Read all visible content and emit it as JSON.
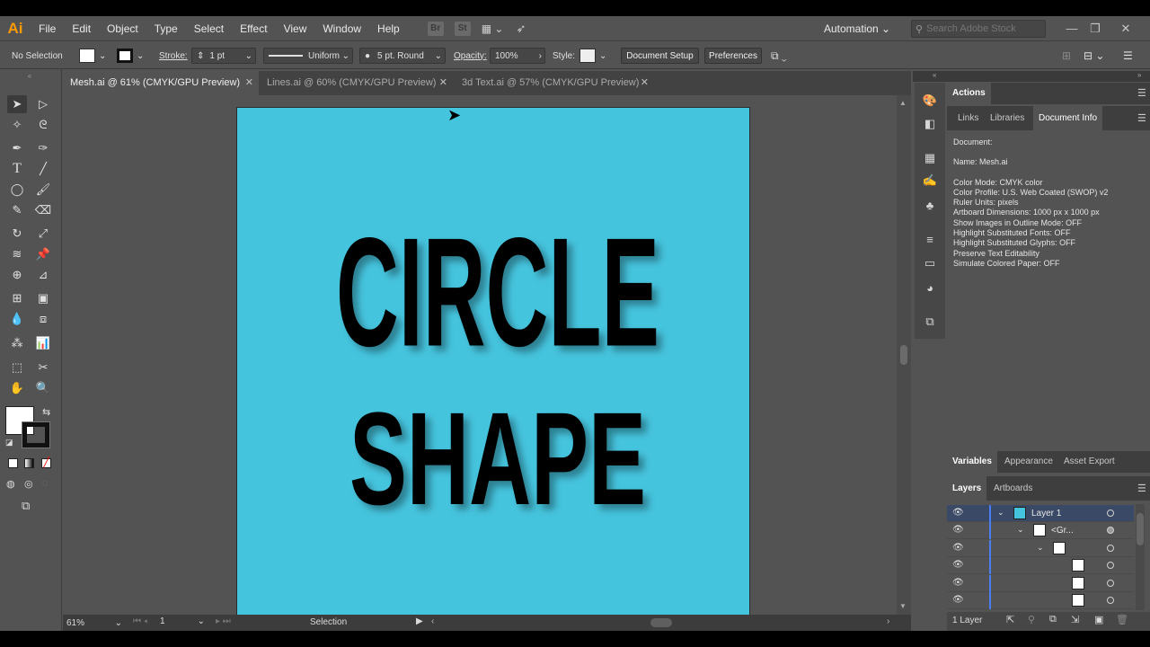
{
  "app": {
    "logo": "Ai"
  },
  "menu": [
    "File",
    "Edit",
    "Object",
    "Type",
    "Select",
    "Effect",
    "View",
    "Window",
    "Help"
  ],
  "menubar": {
    "br_label": "Br",
    "st_label": "St",
    "workspace": "Automation",
    "search_placeholder": "Search Adobe Stock"
  },
  "control_bar": {
    "selection_label": "No Selection",
    "stroke_label": "Stroke:",
    "stroke_weight": "1 pt",
    "profile": "Uniform",
    "brush": "5 pt. Round",
    "opacity_label": "Opacity:",
    "opacity": "100%",
    "style_label": "Style:",
    "document_setup": "Document Setup",
    "preferences": "Preferences"
  },
  "tabs": [
    {
      "label": "Mesh.ai @ 61% (CMYK/GPU Preview)"
    },
    {
      "label": "Lines.ai @ 60% (CMYK/GPU Preview)"
    },
    {
      "label": "3d Text.ai @ 57% (CMYK/GPU Preview)"
    }
  ],
  "artwork": {
    "line1": "CIRCLE",
    "line2": "SHAPE",
    "background": "#45c4de"
  },
  "status": {
    "zoom": "61%",
    "artboard_number": "1",
    "tool": "Selection"
  },
  "panels": {
    "actions": "Actions",
    "doc_tabs": [
      "Links",
      "Libraries",
      "Document Info"
    ],
    "document_info": [
      "Document:",
      "Name: Mesh.ai",
      "Color Mode: CMYK color",
      "Color Profile: U.S. Web Coated (SWOP) v2",
      "Ruler Units: pixels",
      "Artboard Dimensions: 1000 px x 1000 px",
      "Show Images in Outline Mode: OFF",
      "Highlight Substituted Fonts: OFF",
      "Highlight Substituted Glyphs: OFF",
      "Preserve Text Editability",
      "Simulate Colored Paper: OFF"
    ],
    "var_tabs": [
      "Variables",
      "Appearance",
      "Asset Export"
    ],
    "layer_tabs": [
      "Layers",
      "Artboards"
    ],
    "layers": [
      {
        "name": "Layer 1"
      },
      {
        "name": "<Gr..."
      }
    ],
    "layer_count": "1 Layer"
  },
  "colors": {
    "accent": "#4a7ef0",
    "ui_bg": "#535353",
    "logo": "#ff9a00"
  }
}
